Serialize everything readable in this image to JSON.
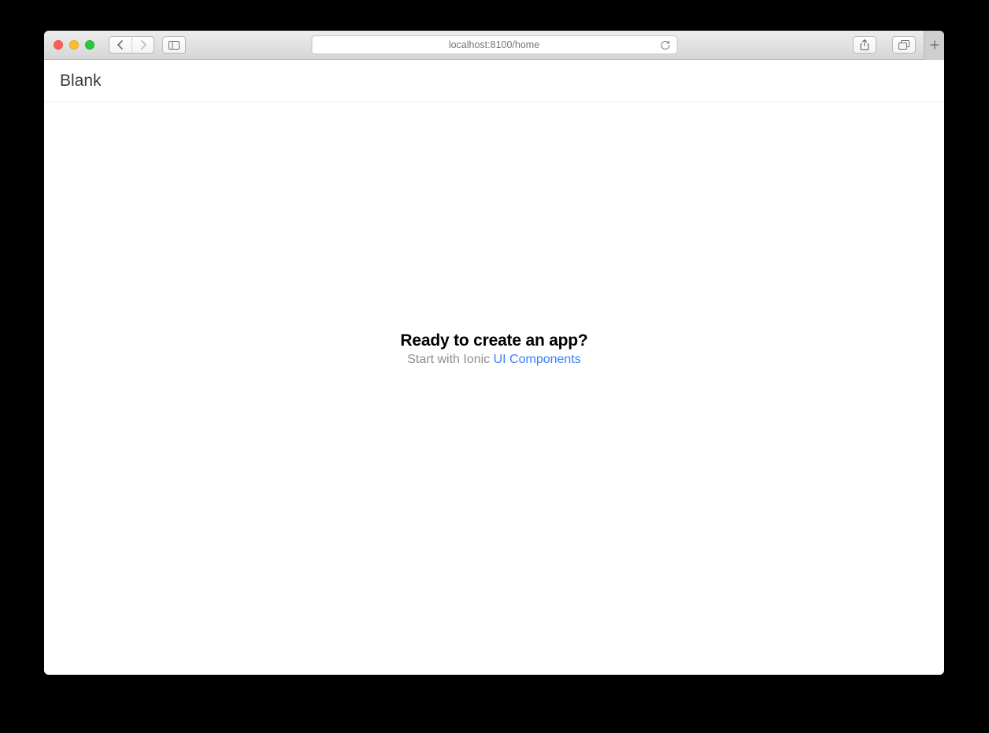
{
  "browser": {
    "address": "localhost:8100/home"
  },
  "page": {
    "title": "Blank",
    "heading": "Ready to create an app?",
    "subtext_prefix": "Start with Ionic ",
    "subtext_link": "UI Components"
  }
}
